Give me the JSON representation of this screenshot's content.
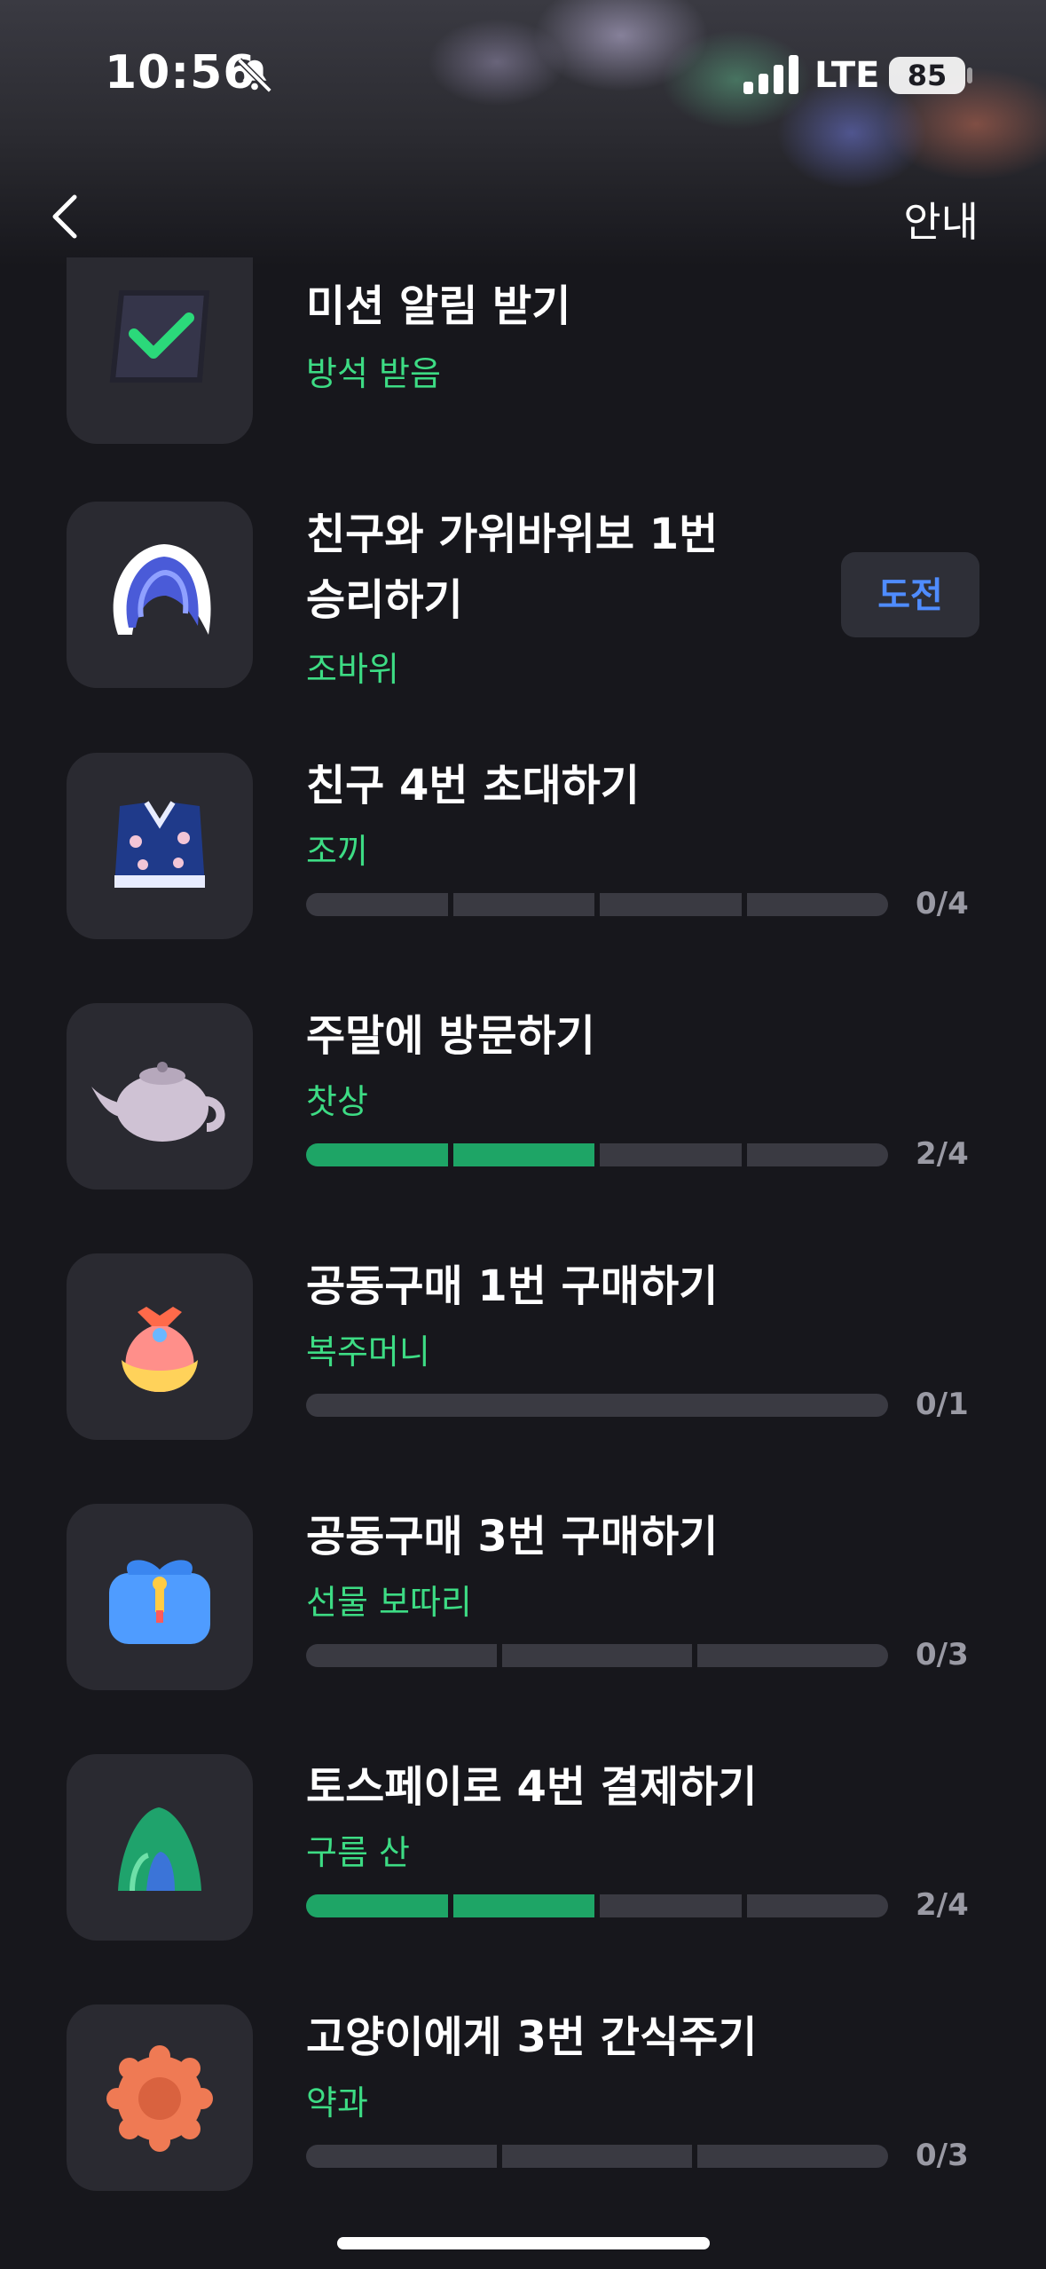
{
  "status_bar": {
    "time": "10:56",
    "network": "LTE",
    "battery": "85"
  },
  "nav": {
    "guide_label": "안내"
  },
  "missions": [
    {
      "title": "미션 알림 받기",
      "reward": "방석 받음",
      "icon": "checkbox-cushion-icon"
    },
    {
      "title_line1": "친구와 가위바위보 1번",
      "title_line2": "승리하기",
      "reward": "조바위",
      "action": "도전",
      "icon": "jobawi-hat-icon"
    },
    {
      "title": "친구 4번 초대하기",
      "reward": "조끼",
      "progress": "0/4",
      "done": 0,
      "total": 4,
      "icon": "vest-icon"
    },
    {
      "title": "주말에 방문하기",
      "reward": "찻상",
      "progress": "2/4",
      "done": 2,
      "total": 4,
      "icon": "teapot-icon"
    },
    {
      "title": "공동구매 1번 구매하기",
      "reward": "복주머니",
      "progress": "0/1",
      "done": 0,
      "total": 1,
      "icon": "lucky-pouch-icon"
    },
    {
      "title": "공동구매 3번 구매하기",
      "reward": "선물 보따리",
      "progress": "0/3",
      "done": 0,
      "total": 3,
      "icon": "gift-bundle-icon"
    },
    {
      "title": "토스페이로 4번 결제하기",
      "reward": "구름 산",
      "progress": "2/4",
      "done": 2,
      "total": 4,
      "icon": "cloud-mountain-icon"
    },
    {
      "title": "고양이에게 3번 간식주기",
      "reward": "약과",
      "progress": "0/3",
      "done": 0,
      "total": 3,
      "icon": "yakgwa-cookie-icon"
    }
  ],
  "colors": {
    "background": "#17171c",
    "card": "#2a2a31",
    "reward": "#3ddc84",
    "progress_on": "#1ea566",
    "progress_off": "#3a3a42",
    "button_text": "#4f8cff"
  }
}
